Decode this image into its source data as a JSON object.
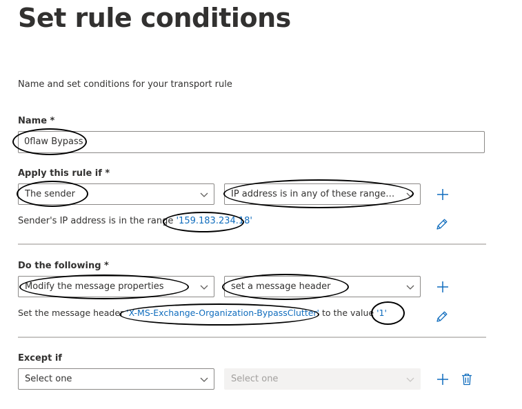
{
  "page": {
    "title": "Set rule conditions",
    "subtitle": "Name and set conditions for your transport rule"
  },
  "name_field": {
    "label": "Name *",
    "value": "0flaw Bypass"
  },
  "apply_rule": {
    "label": "Apply this rule if *",
    "condition_dropdown": "The sender",
    "subcondition_dropdown": "IP address is in any of these ranges or...",
    "description_prefix": "Sender's IP address is in the range",
    "description_value": "'159.183.234.18'"
  },
  "do_following": {
    "label": "Do the following *",
    "action_dropdown": "Modify the message properties",
    "subaction_dropdown": "set a message header",
    "description_prefix": "Set the message header",
    "header_name": "'X-MS-Exchange-Organization-BypassClutter'",
    "description_middle": "to the value",
    "header_value": "'1'"
  },
  "except_if": {
    "label": "Except if",
    "exception_dropdown": "Select one",
    "subexception_dropdown": "Select one"
  },
  "colors": {
    "link": "#0f6cbd",
    "border": "#8a8886",
    "disabled_bg": "#f3f2f1",
    "divider": "#c8c6c4"
  },
  "icons": {
    "add": "plus-icon",
    "edit": "pencil-icon",
    "delete": "trash-icon",
    "dropdown": "chevron-down-icon"
  }
}
